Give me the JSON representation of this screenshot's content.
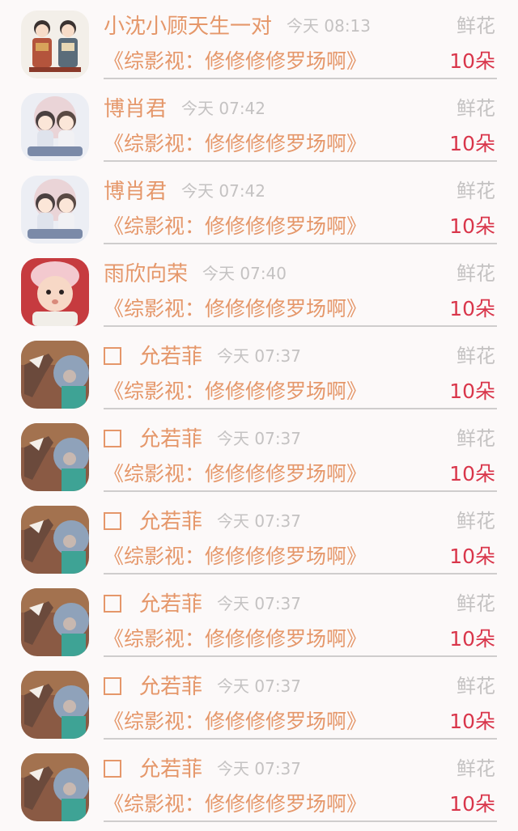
{
  "rows": [
    {
      "name": "小沈小顾天生一对",
      "time": "今天 08:13",
      "gift_label": "鲜花",
      "title": "《综影视：修修修修罗场啊》",
      "count": "10朵",
      "avatar": "couple-costume",
      "checkbox": false
    },
    {
      "name": "博肖君",
      "time": "今天 07:42",
      "gift_label": "鲜花",
      "title": "《综影视：修修修修罗场啊》",
      "count": "10朵",
      "avatar": "chibi-pair",
      "checkbox": false
    },
    {
      "name": "博肖君",
      "time": "今天 07:42",
      "gift_label": "鲜花",
      "title": "《综影视：修修修修罗场啊》",
      "count": "10朵",
      "avatar": "chibi-pair",
      "checkbox": false
    },
    {
      "name": "雨欣向荣",
      "time": "今天 07:40",
      "gift_label": "鲜花",
      "title": "《综影视：修修修修罗场啊》",
      "count": "10朵",
      "avatar": "baby-photo",
      "checkbox": false
    },
    {
      "name": "允若菲",
      "time": "今天 07:37",
      "gift_label": "鲜花",
      "title": "《综影视：修修修修罗场啊》",
      "count": "10朵",
      "avatar": "anime-horse",
      "checkbox": true
    },
    {
      "name": "允若菲",
      "time": "今天 07:37",
      "gift_label": "鲜花",
      "title": "《综影视：修修修修罗场啊》",
      "count": "10朵",
      "avatar": "anime-horse",
      "checkbox": true
    },
    {
      "name": "允若菲",
      "time": "今天 07:37",
      "gift_label": "鲜花",
      "title": "《综影视：修修修修罗场啊》",
      "count": "10朵",
      "avatar": "anime-horse",
      "checkbox": true
    },
    {
      "name": "允若菲",
      "time": "今天 07:37",
      "gift_label": "鲜花",
      "title": "《综影视：修修修修罗场啊》",
      "count": "10朵",
      "avatar": "anime-horse",
      "checkbox": true
    },
    {
      "name": "允若菲",
      "time": "今天 07:37",
      "gift_label": "鲜花",
      "title": "《综影视：修修修修罗场啊》",
      "count": "10朵",
      "avatar": "anime-horse",
      "checkbox": true
    },
    {
      "name": "允若菲",
      "time": "今天 07:37",
      "gift_label": "鲜花",
      "title": "《综影视：修修修修罗场啊》",
      "count": "10朵",
      "avatar": "anime-horse",
      "checkbox": true
    }
  ],
  "colors": {
    "name": "#e5976a",
    "title": "#e5976a",
    "count": "#d9364b",
    "muted": "#c4c2c2",
    "background": "#fcf9f9"
  }
}
